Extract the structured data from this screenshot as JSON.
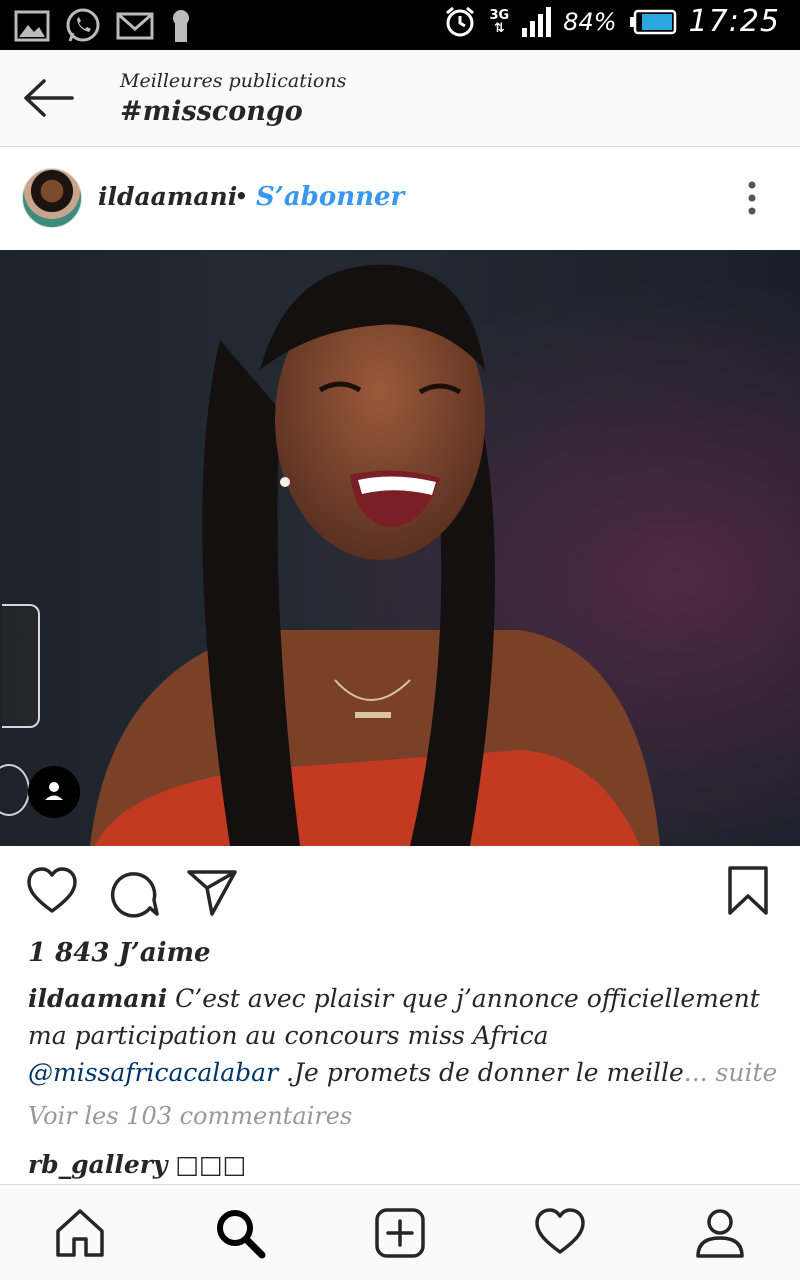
{
  "status_bar": {
    "network": "3G",
    "battery_percent": "84%",
    "time": "17:25",
    "icons": [
      "gallery-icon",
      "whatsapp-icon",
      "gmail-icon",
      "keyhole-icon",
      "alarm-icon",
      "signal-icon",
      "battery-icon"
    ]
  },
  "header": {
    "subtitle": "Meilleures publications",
    "title": "#misscongo"
  },
  "post": {
    "username": "ildaamani",
    "separator": "•",
    "follow_label": "S’abonner",
    "likes": "1 843 J’aime",
    "caption": {
      "username": "ildaamani",
      "text_line_1": " C’est avec plaisir que j’annonce officiellement ma participation au concours miss Africa ",
      "mention": "@missafricacalabar",
      "text_line_2": " .Je promets de donner le meille",
      "ellipsis": "... ",
      "more_label": "suite"
    },
    "comments_link": "Voir les 103 commentaires",
    "first_comment": {
      "username": "rb_gallery",
      "text": " □□□"
    }
  },
  "colors": {
    "accent": "#3897f0",
    "mention": "#003569",
    "muted": "#999999",
    "text": "#262626"
  },
  "bottom_nav": [
    "home-icon",
    "search-icon",
    "add-post-icon",
    "activity-heart-icon",
    "profile-icon"
  ]
}
